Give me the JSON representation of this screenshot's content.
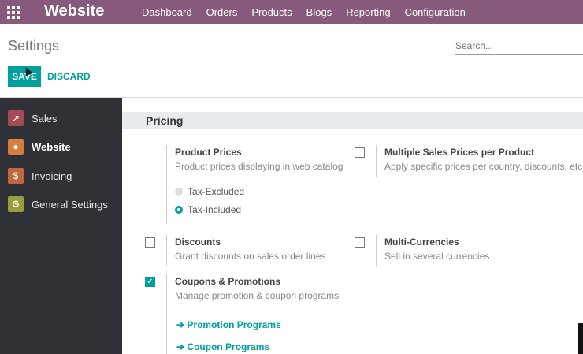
{
  "topbar": {
    "brand": "Website",
    "menu": [
      "Dashboard",
      "Orders",
      "Products",
      "Blogs",
      "Reporting",
      "Configuration"
    ]
  },
  "control": {
    "title": "Settings",
    "search_placeholder": "Search...",
    "save_label": "SAVE",
    "discard_label": "DISCARD"
  },
  "sidebar": {
    "items": [
      {
        "label": "Sales",
        "icon": "sales-icon"
      },
      {
        "label": "Website",
        "icon": "globe-icon"
      },
      {
        "label": "Invoicing",
        "icon": "invoice-icon"
      },
      {
        "label": "General Settings",
        "icon": "gear-icon"
      }
    ]
  },
  "pricing": {
    "section_title": "Pricing",
    "product_prices": {
      "label": "Product Prices",
      "desc": "Product prices displaying in web catalog",
      "options": [
        "Tax-Excluded",
        "Tax-Included"
      ],
      "selected": "Tax-Included"
    },
    "multiple_prices": {
      "label": "Multiple Sales Prices per Product",
      "desc": "Apply specific prices per country, discounts, etc."
    },
    "discounts": {
      "label": "Discounts",
      "desc": "Grant discounts on sales order lines"
    },
    "multi_currencies": {
      "label": "Multi-Currencies",
      "desc": "Sell in several currencies"
    },
    "coupons": {
      "label": "Coupons & Promotions",
      "desc": "Manage promotion & coupon programs",
      "links": [
        "Promotion Programs",
        "Coupon Programs"
      ]
    }
  },
  "colors": {
    "topbar": "#875a7b",
    "accent": "#00a09d",
    "sidebar": "#2f3136"
  }
}
